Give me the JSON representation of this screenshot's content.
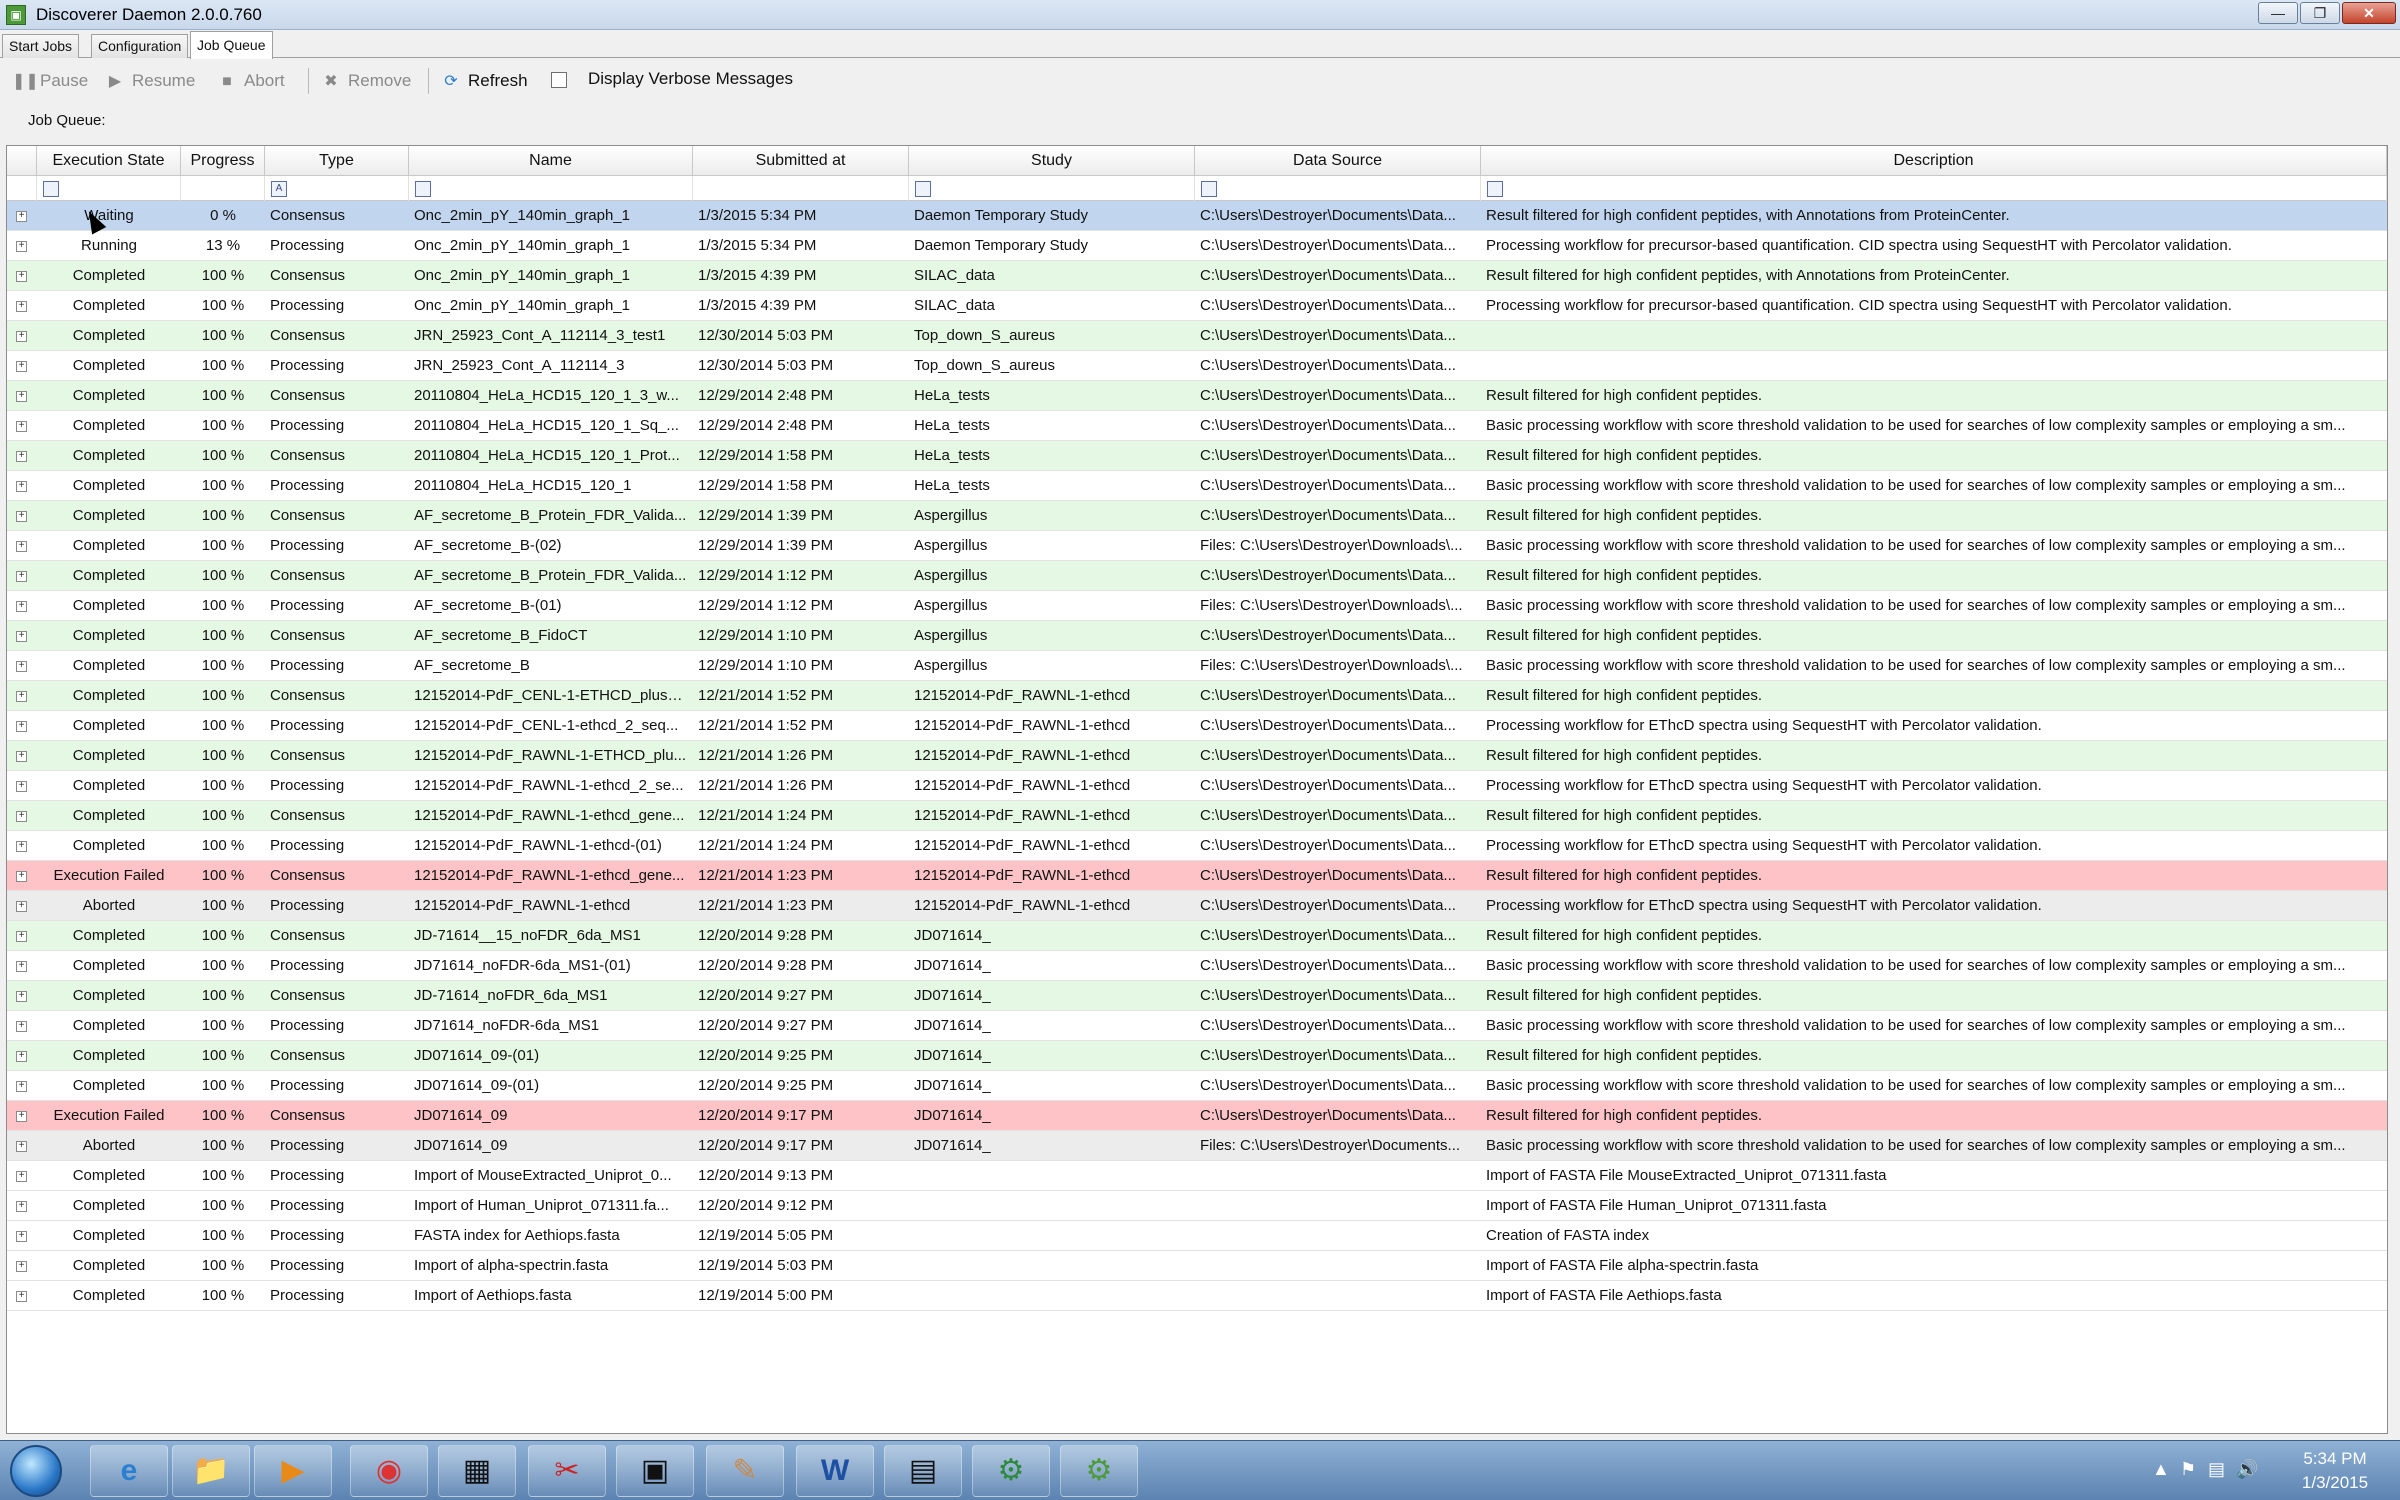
{
  "window": {
    "title": "Discoverer Daemon 2.0.0.760",
    "controls": {
      "minimize": "—",
      "maximize": "❐",
      "close": "✕"
    }
  },
  "tabs": [
    {
      "label": "Start Jobs",
      "active": false
    },
    {
      "label": "Configuration",
      "active": false
    },
    {
      "label": "Job Queue",
      "active": true
    }
  ],
  "toolbar": {
    "pause": "Pause",
    "resume": "Resume",
    "abort": "Abort",
    "remove": "Remove",
    "refresh": "Refresh",
    "verbose_label": "Display Verbose Messages",
    "verbose_checked": false
  },
  "queue_label": "Job Queue:",
  "columns": [
    "Execution State",
    "Progress",
    "Type",
    "Name",
    "Submitted at",
    "Study",
    "Data Source",
    "Description"
  ],
  "rows": [
    {
      "state": "Waiting",
      "progress": "0 %",
      "type": "Consensus",
      "name": "Onc_2min_pY_140min_graph_1",
      "submitted": "1/3/2015 5:34 PM",
      "study": "Daemon Temporary Study",
      "source": "C:\\Users\\Destroyer\\Documents\\Data...",
      "desc": "Result filtered for high confident peptides, with Annotations from ProteinCenter.",
      "style": "selected"
    },
    {
      "state": "Running",
      "progress": "13 %",
      "type": "Processing",
      "name": "Onc_2min_pY_140min_graph_1",
      "submitted": "1/3/2015 5:34 PM",
      "study": "Daemon Temporary Study",
      "source": "C:\\Users\\Destroyer\\Documents\\Data...",
      "desc": "Processing workflow for precursor-based quantification. CID spectra using SequestHT with Percolator validation.",
      "style": "running"
    },
    {
      "state": "Completed",
      "progress": "100 %",
      "type": "Consensus",
      "name": "Onc_2min_pY_140min_graph_1",
      "submitted": "1/3/2015 4:39 PM",
      "study": "SILAC_data",
      "source": "C:\\Users\\Destroyer\\Documents\\Data...",
      "desc": "Result filtered for high confident peptides, with Annotations from ProteinCenter.",
      "style": "completed"
    },
    {
      "state": "Completed",
      "progress": "100 %",
      "type": "Processing",
      "name": "Onc_2min_pY_140min_graph_1",
      "submitted": "1/3/2015 4:39 PM",
      "study": "SILAC_data",
      "source": "C:\\Users\\Destroyer\\Documents\\Data...",
      "desc": "Processing workflow for precursor-based quantification. CID spectra using SequestHT with Percolator validation.",
      "style": "alt"
    },
    {
      "state": "Completed",
      "progress": "100 %",
      "type": "Consensus",
      "name": "JRN_25923_Cont_A_112114_3_test1",
      "submitted": "12/30/2014 5:03 PM",
      "study": "Top_down_S_aureus",
      "source": "C:\\Users\\Destroyer\\Documents\\Data...",
      "desc": "",
      "style": "completed"
    },
    {
      "state": "Completed",
      "progress": "100 %",
      "type": "Processing",
      "name": "JRN_25923_Cont_A_112114_3",
      "submitted": "12/30/2014 5:03 PM",
      "study": "Top_down_S_aureus",
      "source": "C:\\Users\\Destroyer\\Documents\\Data...",
      "desc": "",
      "style": "alt"
    },
    {
      "state": "Completed",
      "progress": "100 %",
      "type": "Consensus",
      "name": "20110804_HeLa_HCD15_120_1_3_w...",
      "submitted": "12/29/2014 2:48 PM",
      "study": "HeLa_tests",
      "source": "C:\\Users\\Destroyer\\Documents\\Data...",
      "desc": "Result filtered for high confident peptides.",
      "style": "completed"
    },
    {
      "state": "Completed",
      "progress": "100 %",
      "type": "Processing",
      "name": "20110804_HeLa_HCD15_120_1_Sq_...",
      "submitted": "12/29/2014 2:48 PM",
      "study": "HeLa_tests",
      "source": "C:\\Users\\Destroyer\\Documents\\Data...",
      "desc": "Basic processing workflow with score threshold validation to be used for searches of low complexity samples or employing a sm...",
      "style": "alt"
    },
    {
      "state": "Completed",
      "progress": "100 %",
      "type": "Consensus",
      "name": "20110804_HeLa_HCD15_120_1_Prot...",
      "submitted": "12/29/2014 1:58 PM",
      "study": "HeLa_tests",
      "source": "C:\\Users\\Destroyer\\Documents\\Data...",
      "desc": "Result filtered for high confident peptides.",
      "style": "completed"
    },
    {
      "state": "Completed",
      "progress": "100 %",
      "type": "Processing",
      "name": "20110804_HeLa_HCD15_120_1",
      "submitted": "12/29/2014 1:58 PM",
      "study": "HeLa_tests",
      "source": "C:\\Users\\Destroyer\\Documents\\Data...",
      "desc": "Basic processing workflow with score threshold validation to be used for searches of low complexity samples or employing a sm...",
      "style": "alt"
    },
    {
      "state": "Completed",
      "progress": "100 %",
      "type": "Consensus",
      "name": "AF_secretome_B_Protein_FDR_Valida...",
      "submitted": "12/29/2014 1:39 PM",
      "study": "Aspergillus",
      "source": "C:\\Users\\Destroyer\\Documents\\Data...",
      "desc": "Result filtered for high confident peptides.",
      "style": "completed"
    },
    {
      "state": "Completed",
      "progress": "100 %",
      "type": "Processing",
      "name": "AF_secretome_B-(02)",
      "submitted": "12/29/2014 1:39 PM",
      "study": "Aspergillus",
      "source": "Files: C:\\Users\\Destroyer\\Downloads\\...",
      "desc": "Basic processing workflow with score threshold validation to be used for searches of low complexity samples or employing a sm...",
      "style": "alt"
    },
    {
      "state": "Completed",
      "progress": "100 %",
      "type": "Consensus",
      "name": "AF_secretome_B_Protein_FDR_Valida...",
      "submitted": "12/29/2014 1:12 PM",
      "study": "Aspergillus",
      "source": "C:\\Users\\Destroyer\\Documents\\Data...",
      "desc": "Result filtered for high confident peptides.",
      "style": "completed"
    },
    {
      "state": "Completed",
      "progress": "100 %",
      "type": "Processing",
      "name": "AF_secretome_B-(01)",
      "submitted": "12/29/2014 1:12 PM",
      "study": "Aspergillus",
      "source": "Files: C:\\Users\\Destroyer\\Downloads\\...",
      "desc": "Basic processing workflow with score threshold validation to be used for searches of low complexity samples or employing a sm...",
      "style": "alt"
    },
    {
      "state": "Completed",
      "progress": "100 %",
      "type": "Consensus",
      "name": "AF_secretome_B_FidoCT",
      "submitted": "12/29/2014 1:10 PM",
      "study": "Aspergillus",
      "source": "C:\\Users\\Destroyer\\Documents\\Data...",
      "desc": "Result filtered for high confident peptides.",
      "style": "completed"
    },
    {
      "state": "Completed",
      "progress": "100 %",
      "type": "Processing",
      "name": "AF_secretome_B",
      "submitted": "12/29/2014 1:10 PM",
      "study": "Aspergillus",
      "source": "Files: C:\\Users\\Destroyer\\Downloads\\...",
      "desc": "Basic processing workflow with score threshold validation to be used for searches of low complexity samples or employing a sm...",
      "style": "alt"
    },
    {
      "state": "Completed",
      "progress": "100 %",
      "type": "Consensus",
      "name": "12152014-PdF_CENL-1-ETHCD_plus_...",
      "submitted": "12/21/2014 1:52 PM",
      "study": "12152014-PdF_RAWNL-1-ethcd",
      "source": "C:\\Users\\Destroyer\\Documents\\Data...",
      "desc": "Result filtered for high confident peptides.",
      "style": "completed"
    },
    {
      "state": "Completed",
      "progress": "100 %",
      "type": "Processing",
      "name": "12152014-PdF_CENL-1-ethcd_2_seq...",
      "submitted": "12/21/2014 1:52 PM",
      "study": "12152014-PdF_RAWNL-1-ethcd",
      "source": "C:\\Users\\Destroyer\\Documents\\Data...",
      "desc": "Processing workflow for EThcD spectra using SequestHT with Percolator validation.",
      "style": "alt"
    },
    {
      "state": "Completed",
      "progress": "100 %",
      "type": "Consensus",
      "name": "12152014-PdF_RAWNL-1-ETHCD_plu...",
      "submitted": "12/21/2014 1:26 PM",
      "study": "12152014-PdF_RAWNL-1-ethcd",
      "source": "C:\\Users\\Destroyer\\Documents\\Data...",
      "desc": "Result filtered for high confident peptides.",
      "style": "completed"
    },
    {
      "state": "Completed",
      "progress": "100 %",
      "type": "Processing",
      "name": "12152014-PdF_RAWNL-1-ethcd_2_se...",
      "submitted": "12/21/2014 1:26 PM",
      "study": "12152014-PdF_RAWNL-1-ethcd",
      "source": "C:\\Users\\Destroyer\\Documents\\Data...",
      "desc": "Processing workflow for EThcD spectra using SequestHT with Percolator validation.",
      "style": "alt"
    },
    {
      "state": "Completed",
      "progress": "100 %",
      "type": "Consensus",
      "name": "12152014-PdF_RAWNL-1-ethcd_gene...",
      "submitted": "12/21/2014 1:24 PM",
      "study": "12152014-PdF_RAWNL-1-ethcd",
      "source": "C:\\Users\\Destroyer\\Documents\\Data...",
      "desc": "Result filtered for high confident peptides.",
      "style": "completed"
    },
    {
      "state": "Completed",
      "progress": "100 %",
      "type": "Processing",
      "name": "12152014-PdF_RAWNL-1-ethcd-(01)",
      "submitted": "12/21/2014 1:24 PM",
      "study": "12152014-PdF_RAWNL-1-ethcd",
      "source": "C:\\Users\\Destroyer\\Documents\\Data...",
      "desc": "Processing workflow for EThcD spectra using SequestHT with Percolator validation.",
      "style": "alt"
    },
    {
      "state": "Execution Failed",
      "progress": "100 %",
      "type": "Consensus",
      "name": "12152014-PdF_RAWNL-1-ethcd_gene...",
      "submitted": "12/21/2014 1:23 PM",
      "study": "12152014-PdF_RAWNL-1-ethcd",
      "source": "C:\\Users\\Destroyer\\Documents\\Data...",
      "desc": "Result filtered for high confident peptides.",
      "style": "failed"
    },
    {
      "state": "Aborted",
      "progress": "100 %",
      "type": "Processing",
      "name": "12152014-PdF_RAWNL-1-ethcd",
      "submitted": "12/21/2014 1:23 PM",
      "study": "12152014-PdF_RAWNL-1-ethcd",
      "source": "C:\\Users\\Destroyer\\Documents\\Data...",
      "desc": "Processing workflow for EThcD spectra using SequestHT with Percolator validation.",
      "style": "aborted"
    },
    {
      "state": "Completed",
      "progress": "100 %",
      "type": "Consensus",
      "name": "JD-71614__15_noFDR_6da_MS1",
      "submitted": "12/20/2014 9:28 PM",
      "study": "JD071614_",
      "source": "C:\\Users\\Destroyer\\Documents\\Data...",
      "desc": "Result filtered for high confident peptides.",
      "style": "completed"
    },
    {
      "state": "Completed",
      "progress": "100 %",
      "type": "Processing",
      "name": "JD71614_noFDR-6da_MS1-(01)",
      "submitted": "12/20/2014 9:28 PM",
      "study": "JD071614_",
      "source": "C:\\Users\\Destroyer\\Documents\\Data...",
      "desc": "Basic processing workflow with score threshold validation to be used for searches of low complexity samples or employing a sm...",
      "style": "alt"
    },
    {
      "state": "Completed",
      "progress": "100 %",
      "type": "Consensus",
      "name": "JD-71614_noFDR_6da_MS1",
      "submitted": "12/20/2014 9:27 PM",
      "study": "JD071614_",
      "source": "C:\\Users\\Destroyer\\Documents\\Data...",
      "desc": "Result filtered for high confident peptides.",
      "style": "completed"
    },
    {
      "state": "Completed",
      "progress": "100 %",
      "type": "Processing",
      "name": "JD71614_noFDR-6da_MS1",
      "submitted": "12/20/2014 9:27 PM",
      "study": "JD071614_",
      "source": "C:\\Users\\Destroyer\\Documents\\Data...",
      "desc": "Basic processing workflow with score threshold validation to be used for searches of low complexity samples or employing a sm...",
      "style": "alt"
    },
    {
      "state": "Completed",
      "progress": "100 %",
      "type": "Consensus",
      "name": "JD071614_09-(01)",
      "submitted": "12/20/2014 9:25 PM",
      "study": "JD071614_",
      "source": "C:\\Users\\Destroyer\\Documents\\Data...",
      "desc": "Result filtered for high confident peptides.",
      "style": "completed"
    },
    {
      "state": "Completed",
      "progress": "100 %",
      "type": "Processing",
      "name": "JD071614_09-(01)",
      "submitted": "12/20/2014 9:25 PM",
      "study": "JD071614_",
      "source": "C:\\Users\\Destroyer\\Documents\\Data...",
      "desc": "Basic processing workflow with score threshold validation to be used for searches of low complexity samples or employing a sm...",
      "style": "alt"
    },
    {
      "state": "Execution Failed",
      "progress": "100 %",
      "type": "Consensus",
      "name": "JD071614_09",
      "submitted": "12/20/2014 9:17 PM",
      "study": "JD071614_",
      "source": "C:\\Users\\Destroyer\\Documents\\Data...",
      "desc": "Result filtered for high confident peptides.",
      "style": "failed"
    },
    {
      "state": "Aborted",
      "progress": "100 %",
      "type": "Processing",
      "name": "JD071614_09",
      "submitted": "12/20/2014 9:17 PM",
      "study": "JD071614_",
      "source": "Files: C:\\Users\\Destroyer\\Documents...",
      "desc": "Basic processing workflow with score threshold validation to be used for searches of low complexity samples or employing a sm...",
      "style": "aborted"
    },
    {
      "state": "Completed",
      "progress": "100 %",
      "type": "Processing",
      "name": "Import of MouseExtracted_Uniprot_0...",
      "submitted": "12/20/2014 9:13 PM",
      "study": "",
      "source": "",
      "desc": "Import of FASTA File MouseExtracted_Uniprot_071311.fasta",
      "style": "alt"
    },
    {
      "state": "Completed",
      "progress": "100 %",
      "type": "Processing",
      "name": "Import of Human_Uniprot_071311.fa...",
      "submitted": "12/20/2014 9:12 PM",
      "study": "",
      "source": "",
      "desc": "Import of FASTA File Human_Uniprot_071311.fasta",
      "style": "alt"
    },
    {
      "state": "Completed",
      "progress": "100 %",
      "type": "Processing",
      "name": "FASTA index for Aethiops.fasta",
      "submitted": "12/19/2014 5:05 PM",
      "study": "",
      "source": "",
      "desc": "Creation of FASTA index",
      "style": "alt"
    },
    {
      "state": "Completed",
      "progress": "100 %",
      "type": "Processing",
      "name": "Import of alpha-spectrin.fasta",
      "submitted": "12/19/2014 5:03 PM",
      "study": "",
      "source": "",
      "desc": "Import of FASTA File alpha-spectrin.fasta",
      "style": "alt"
    },
    {
      "state": "Completed",
      "progress": "100 %",
      "type": "Processing",
      "name": "Import of Aethiops.fasta",
      "submitted": "12/19/2014 5:00 PM",
      "study": "",
      "source": "",
      "desc": "Import of FASTA File Aethiops.fasta",
      "style": "alt"
    }
  ],
  "taskbar": {
    "items": [
      "internet-explorer",
      "file-explorer",
      "media-player",
      "chrome",
      "calculator",
      "snipping-tool",
      "remote-desktop",
      "paint",
      "word",
      "control-panel",
      "discoverer",
      "daemon"
    ],
    "clock_time": "5:34 PM",
    "clock_date": "1/3/2015"
  }
}
